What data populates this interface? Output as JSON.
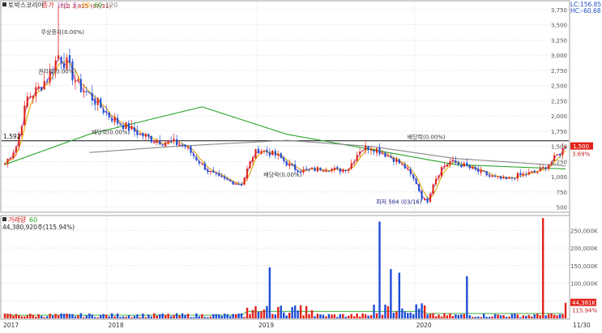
{
  "header": {
    "stock_name": "토박스코리아",
    "price_legend": [
      "종가",
      "단순",
      "5",
      "20",
      "60",
      "120"
    ],
    "lc": "LC:156.85",
    "hc": "HC:-60.68"
  },
  "volume_header": {
    "title": "거래량",
    "period": "60",
    "value_text": "44,380,920주(115.94%)"
  },
  "colors": {
    "up": "#e2231a",
    "down": "#1f4ed8",
    "ma5": "#bb66bb",
    "ma20": "#e0a800",
    "ma60": "#2aa52a",
    "ma120": "#888888",
    "grid": "#c8c8c8",
    "hline": "#111111",
    "current_price_bg": "#e2231a",
    "volume_label_bg": "#e2231a"
  },
  "chart_data": [
    {
      "type": "candlestick",
      "title": "토박스코리아",
      "y_ticks": [
        500,
        750,
        1000,
        1250,
        1500,
        1750,
        2000,
        2250,
        2500,
        2750,
        3000,
        3250,
        3500,
        3750
      ],
      "y_tick_labels": [
        "500",
        "750",
        "1,000",
        "1,250",
        "1,500",
        "1,750",
        "2,000",
        "2,250",
        "2,500",
        "2,750",
        "3,000",
        "3,250",
        "3,500",
        "3,750"
      ],
      "ylim": [
        430,
        3880
      ],
      "x_ticks": [
        "2017",
        "2018",
        "2019",
        "2020",
        "11/30"
      ],
      "ma_periods": [
        5,
        20,
        60,
        120
      ],
      "horizontal_line": {
        "value": 1592,
        "label": "1,592"
      },
      "current_price": {
        "value": 1500,
        "label": "1,500",
        "change": "3.69%"
      },
      "annotations": [
        {
          "text": "최고 3,815 (07/31)",
          "value": 3815
        },
        {
          "text": "무상증자(0.00%)",
          "value": 3350
        },
        {
          "text": "권리락(0.00%)",
          "value": 2700
        },
        {
          "text": "배당락(0.00%)",
          "value": 1700
        },
        {
          "text": "배당락(0.00%)",
          "value": 1000
        },
        {
          "text": "배당락(0.00%)",
          "value": 1620
        },
        {
          "text": "최저 584 (03/16)",
          "value": 584
        }
      ]
    },
    {
      "type": "bar",
      "title": "거래량",
      "y_ticks": [
        50000,
        100000,
        150000,
        200000,
        250000
      ],
      "y_tick_labels": [
        "50,000K",
        "100,000K",
        "150,000K",
        "200,000K",
        "250,000K"
      ],
      "ylim": [
        0,
        290000
      ],
      "unit": "K",
      "last_value_label": "44,381K",
      "last_ratio_label": "115.94%",
      "peaks": [
        {
          "date_label": "2019-01",
          "value": 145000
        },
        {
          "date_label": "2019-06",
          "value": 275000
        },
        {
          "date_label": "2019-07",
          "value": 140000
        },
        {
          "date_label": "2019-08",
          "value": 130000
        },
        {
          "date_label": "2020-03",
          "value": 120000
        },
        {
          "date_label": "2020-11",
          "value": 285000
        }
      ]
    }
  ]
}
